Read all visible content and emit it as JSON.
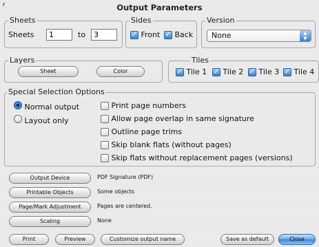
{
  "window": {
    "title": "Output Parameters",
    "corner_mark": "r"
  },
  "sheets": {
    "legend": "Sheets",
    "label": "Sheets",
    "from_value": "1",
    "to_label": "to",
    "to_value": "3"
  },
  "sides": {
    "legend": "Sides",
    "front_label": "Front",
    "front_checked": true,
    "back_label": "Back",
    "back_checked": true
  },
  "version": {
    "legend": "Version",
    "selected": "None"
  },
  "layers": {
    "legend": "Layers",
    "sheet_label": "Sheet",
    "color_label": "Color"
  },
  "tiles": {
    "legend": "Tiles",
    "items": [
      {
        "label": "Tile 1",
        "checked": true
      },
      {
        "label": "Tile 2",
        "checked": true
      },
      {
        "label": "Tile 3",
        "checked": true
      },
      {
        "label": "Tile 4",
        "checked": true
      }
    ]
  },
  "special": {
    "legend": "Special Selection Options",
    "radios": [
      {
        "label": "Normal output",
        "selected": true
      },
      {
        "label": "Layout only",
        "selected": false
      }
    ],
    "checks": [
      {
        "label": "Print page numbers",
        "checked": false
      },
      {
        "label": "Allow page overlap in same signature",
        "checked": false
      },
      {
        "label": "Outline page trims",
        "checked": false
      },
      {
        "label": "Skip blank flats (without pages)",
        "checked": false
      },
      {
        "label": "Skip flats without replacement pages (versions)",
        "checked": false
      }
    ]
  },
  "settings": [
    {
      "button": "Output Device",
      "value": "PDF Signature (PDF)"
    },
    {
      "button": "Printable Objects",
      "value": "Some objects"
    },
    {
      "button": "Page/Mark Adjustment",
      "value": "Pages are centered."
    },
    {
      "button": "Scaling",
      "value": "None"
    }
  ],
  "footer": {
    "print": "Print",
    "preview": "Preview",
    "customize": "Customize output name",
    "save_default": "Save as default",
    "close": "Close"
  },
  "colors": {
    "accent": "#3e86d6",
    "checkmark": "✓"
  }
}
